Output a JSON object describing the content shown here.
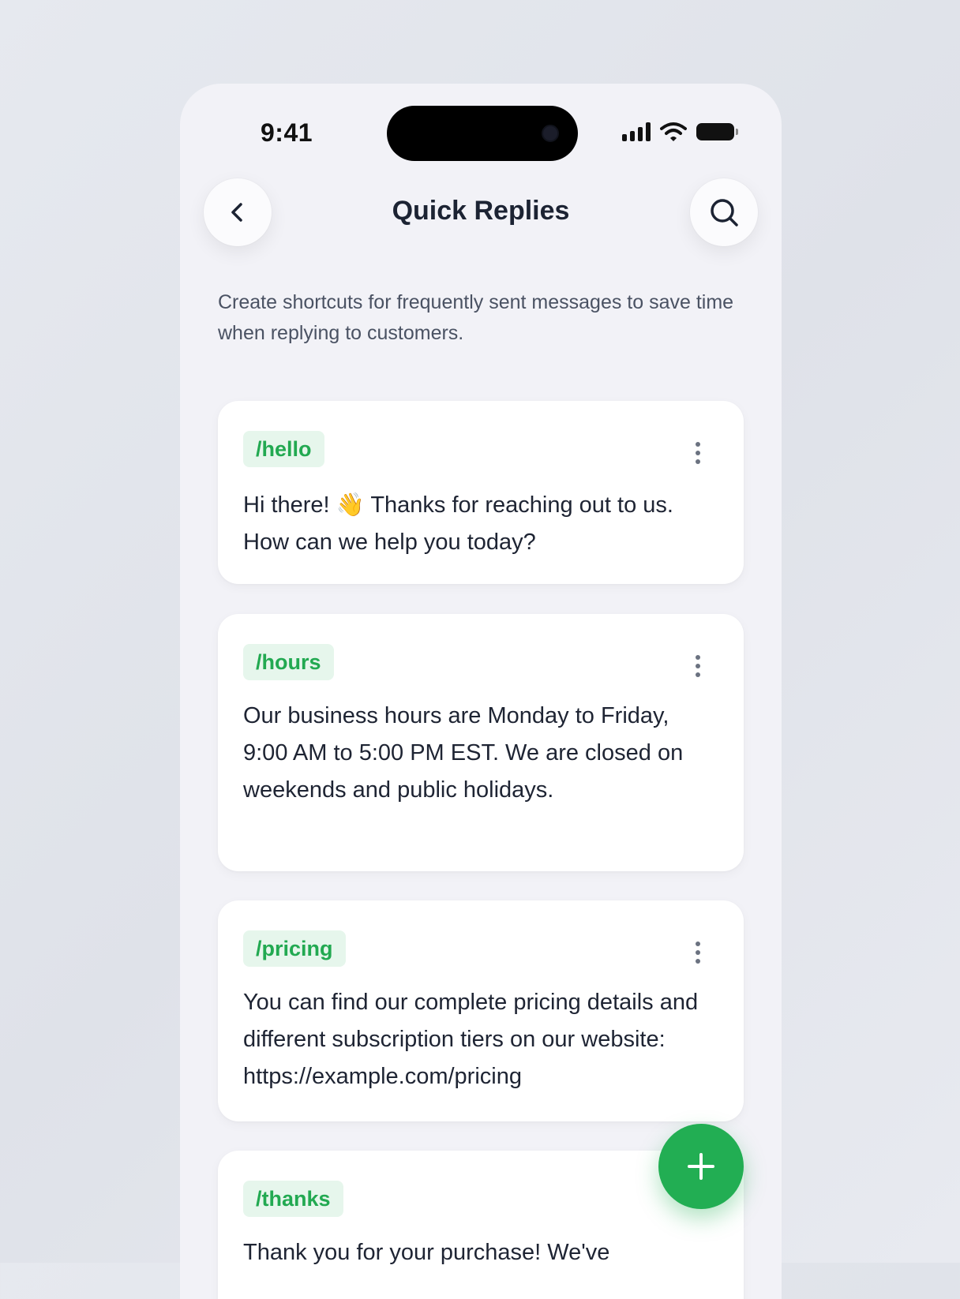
{
  "status_bar": {
    "time": "9:41"
  },
  "header": {
    "title": "Quick Replies"
  },
  "subtitle": "Create shortcuts for frequently sent messages to save time when replying to customers.",
  "replies": [
    {
      "shortcut": "/hello",
      "text_before": "Hi there! ",
      "emoji": "👋",
      "text_after": " Thanks for reaching out to us. How can we help you today?"
    },
    {
      "shortcut": "/hours",
      "text": "Our business hours are Monday to Friday, 9:00 AM to 5:00 PM EST. We are closed on weekends and public holidays."
    },
    {
      "shortcut": "/pricing",
      "text": "You can find our complete pricing details and different subscription tiers on our website: https://example.com/pricing"
    },
    {
      "shortcut": "/thanks",
      "text": "Thank you for your purchase! We've"
    }
  ],
  "colors": {
    "accent": "#22ae53",
    "tag_bg": "#e6f6ec",
    "tag_text": "#22a951",
    "background": "#f2f2f7"
  },
  "icons": {
    "back": "chevron-left-icon",
    "search": "search-icon",
    "more": "more-vertical-icon",
    "add": "plus-icon"
  }
}
